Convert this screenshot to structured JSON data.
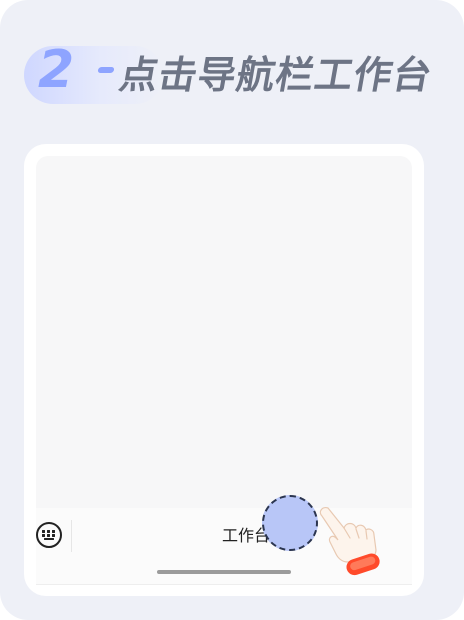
{
  "step": {
    "number": "2",
    "title": "点击导航栏工作台"
  },
  "nav": {
    "tab_label": "工作台",
    "keyboard_icon": "keyboard-icon"
  },
  "pointer": {
    "icon": "tap-hand-icon"
  },
  "colors": {
    "accent": "#8ea4ff",
    "title_text": "#6d7485",
    "card_background": "#eef0f7",
    "tap_highlight": "#b8c6f7"
  }
}
